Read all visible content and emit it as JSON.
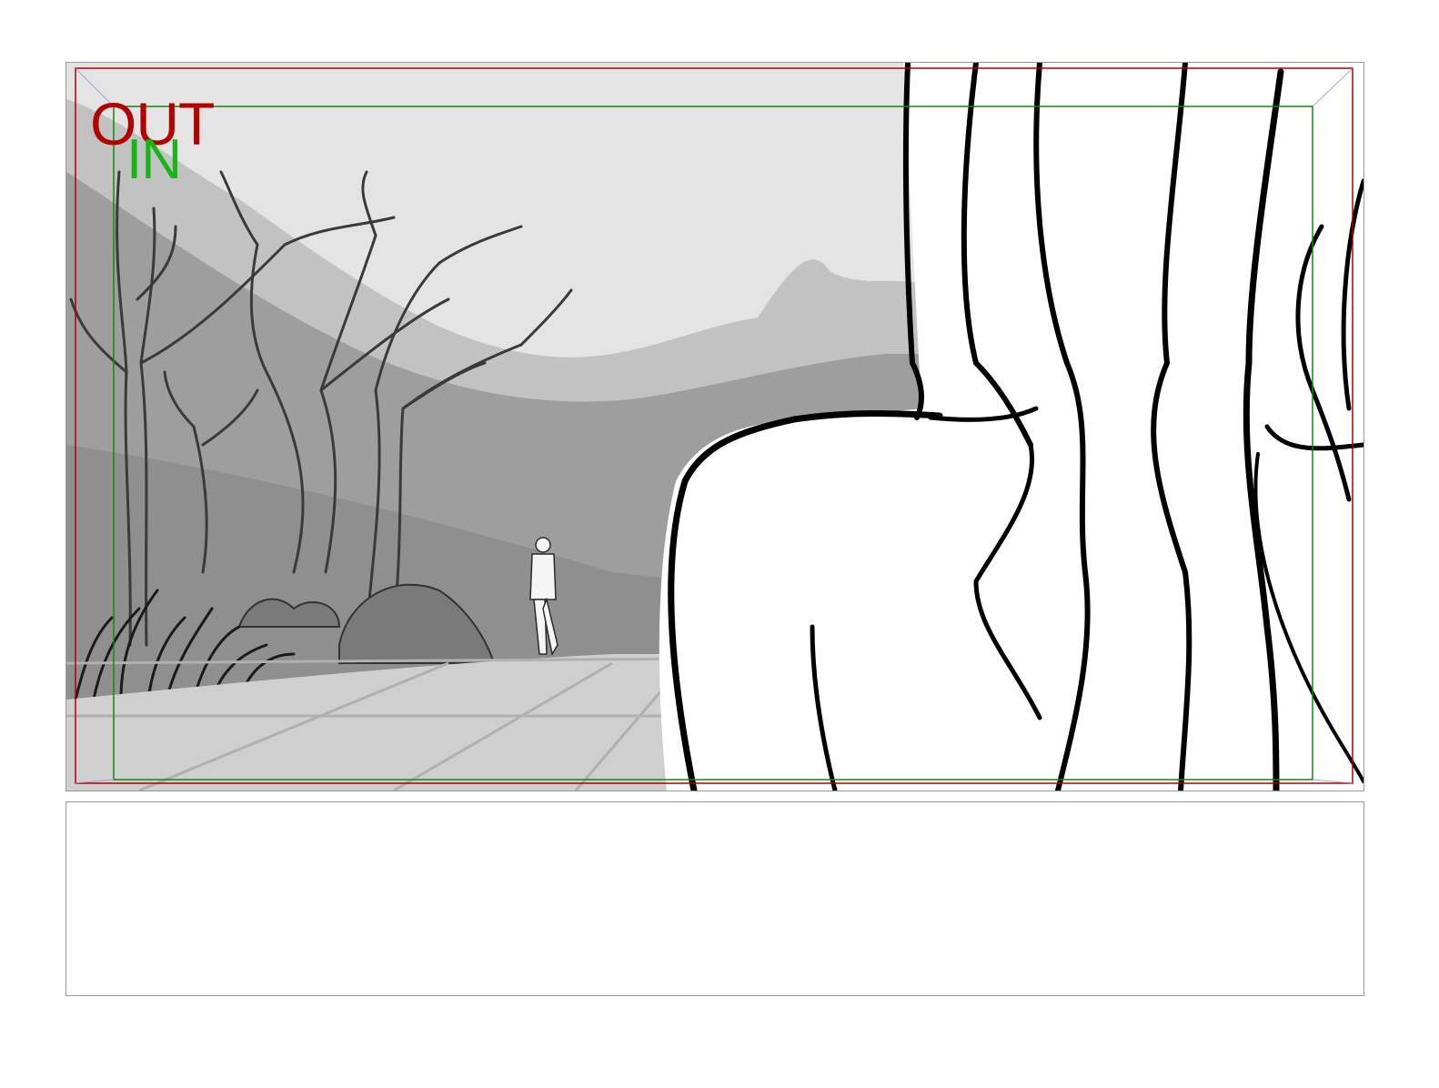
{
  "storyboard": {
    "frame_labels": {
      "out": "OUT",
      "in": "IN"
    },
    "colors": {
      "out_frame": "#b00000",
      "in_frame": "#0f8a0f",
      "out_label": "#b30000",
      "in_label": "#17b517",
      "panel_border": "#9a9a9a",
      "corner_guides": "#8f8fe0"
    },
    "notes_text": ""
  }
}
